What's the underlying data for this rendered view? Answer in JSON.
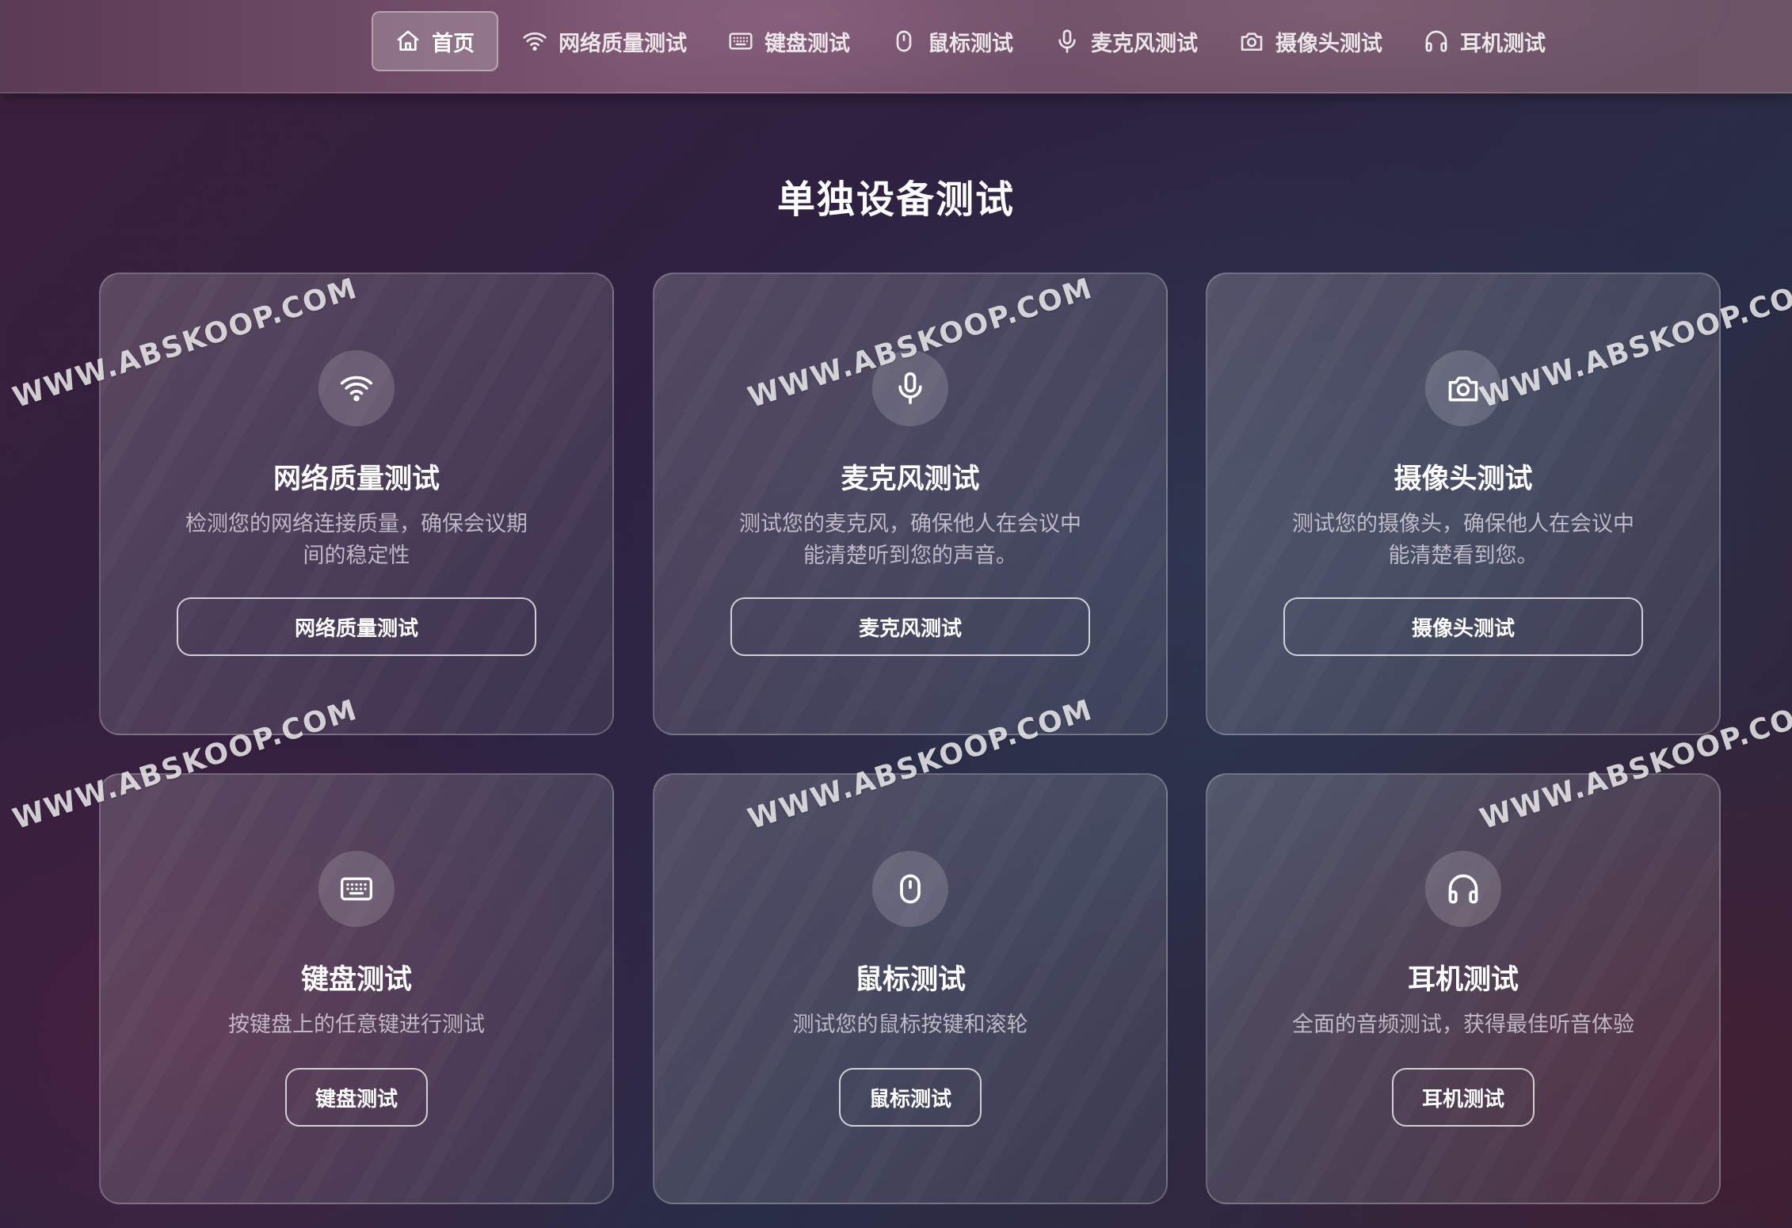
{
  "nav": {
    "items": [
      {
        "label": "首页",
        "icon": "home-icon",
        "active": true
      },
      {
        "label": "网络质量测试",
        "icon": "wifi-icon",
        "active": false
      },
      {
        "label": "键盘测试",
        "icon": "keyboard-icon",
        "active": false
      },
      {
        "label": "鼠标测试",
        "icon": "mouse-icon",
        "active": false
      },
      {
        "label": "麦克风测试",
        "icon": "microphone-icon",
        "active": false
      },
      {
        "label": "摄像头测试",
        "icon": "camera-icon",
        "active": false
      },
      {
        "label": "耳机测试",
        "icon": "headphones-icon",
        "active": false
      }
    ]
  },
  "section": {
    "title": "单独设备测试"
  },
  "cards": [
    {
      "icon": "wifi-icon",
      "title": "网络质量测试",
      "description": "检测您的网络连接质量，确保会议期间的稳定性",
      "button": "网络质量测试"
    },
    {
      "icon": "microphone-icon",
      "title": "麦克风测试",
      "description": "测试您的麦克风，确保他人在会议中能清楚听到您的声音。",
      "button": "麦克风测试"
    },
    {
      "icon": "camera-icon",
      "title": "摄像头测试",
      "description": "测试您的摄像头，确保他人在会议中能清楚看到您。",
      "button": "摄像头测试"
    },
    {
      "icon": "keyboard-icon",
      "title": "键盘测试",
      "description": "按键盘上的任意键进行测试",
      "button": "键盘测试"
    },
    {
      "icon": "mouse-icon",
      "title": "鼠标测试",
      "description": "测试您的鼠标按键和滚轮",
      "button": "鼠标测试"
    },
    {
      "icon": "headphones-icon",
      "title": "耳机测试",
      "description": "全面的音频测试，获得最佳听音体验",
      "button": "耳机测试"
    }
  ],
  "watermark": {
    "text": "WWW.ABSKOOP.COM"
  },
  "colors": {
    "background_start": "#3b1f3c",
    "background_end": "#2a2d47",
    "topbar": "#6f5068",
    "text_primary": "#ffffff",
    "text_secondary": "#b9b0c0"
  }
}
